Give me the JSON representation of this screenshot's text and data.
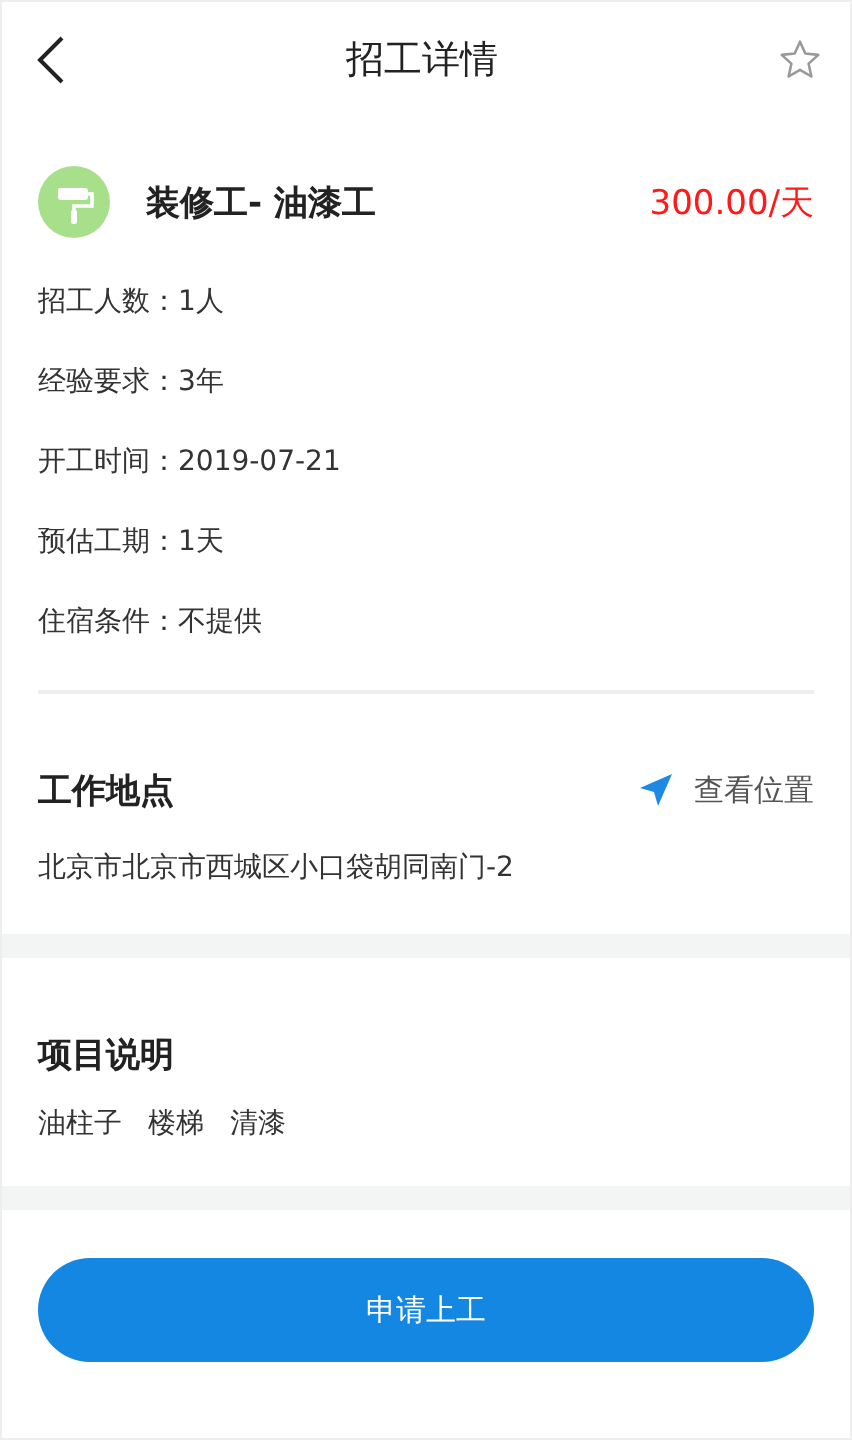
{
  "header": {
    "title": "招工详情",
    "favorited": false
  },
  "job": {
    "title": "装修工- 油漆工",
    "wage": "300.00/天"
  },
  "details": [
    {
      "label": "招工人数：",
      "value": "1人"
    },
    {
      "label": "经验要求：",
      "value": "3年"
    },
    {
      "label": "开工时间：",
      "value": "2019-07-21"
    },
    {
      "label": "预估工期：",
      "value": "1天"
    },
    {
      "label": "住宿条件：",
      "value": "不提供"
    }
  ],
  "location": {
    "heading": "工作地点",
    "link": "查看位置",
    "address": "北京市北京市西城区小口袋胡同南门-2"
  },
  "project": {
    "heading": "项目说明",
    "tags": [
      "油柱子",
      "楼梯",
      "清漆"
    ]
  },
  "action_button": "申请上工"
}
